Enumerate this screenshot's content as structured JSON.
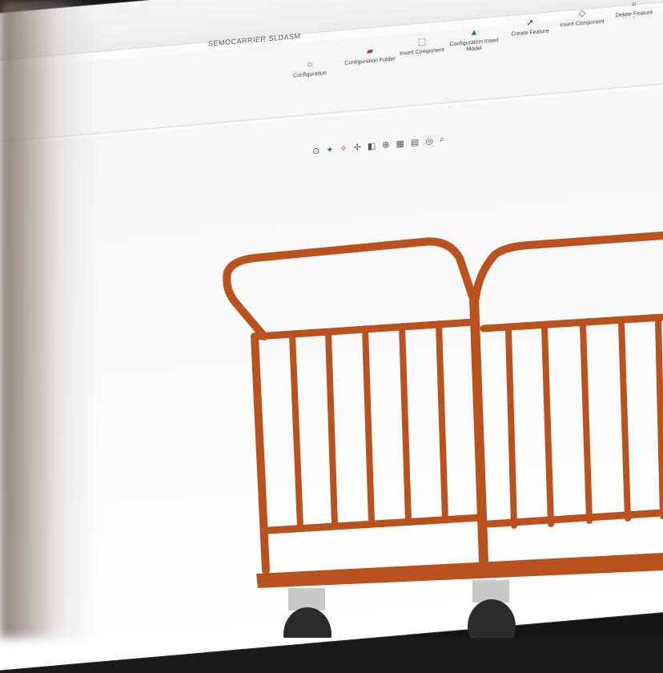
{
  "window": {
    "title": "SEMOCARRIER.SLDASM",
    "controls": [
      "?",
      "▢",
      "●"
    ]
  },
  "ribbon": {
    "items": [
      {
        "label": "Configuration",
        "icon": "circle-icon"
      },
      {
        "label": "Configuration Folder",
        "icon": "folder-red-icon"
      },
      {
        "label": "Insert Component",
        "icon": "component-icon"
      },
      {
        "label": "Configuration Insert Model",
        "icon": "model-green-icon"
      },
      {
        "label": "Create Feature",
        "icon": "feature-icon"
      },
      {
        "label": "Insert Component",
        "icon": "insert-icon"
      },
      {
        "label": "Delete Feature",
        "icon": "delete-icon"
      }
    ]
  },
  "viewbar": {
    "icons": [
      "⊙",
      "✦",
      "✧",
      "✢",
      "◧",
      "⊕",
      "▦",
      "▤",
      "◎",
      "⌕"
    ]
  },
  "model": {
    "color": "#b9521f",
    "wheel_color": "#2b2b2b",
    "caster_color": "#c9c9c9"
  }
}
